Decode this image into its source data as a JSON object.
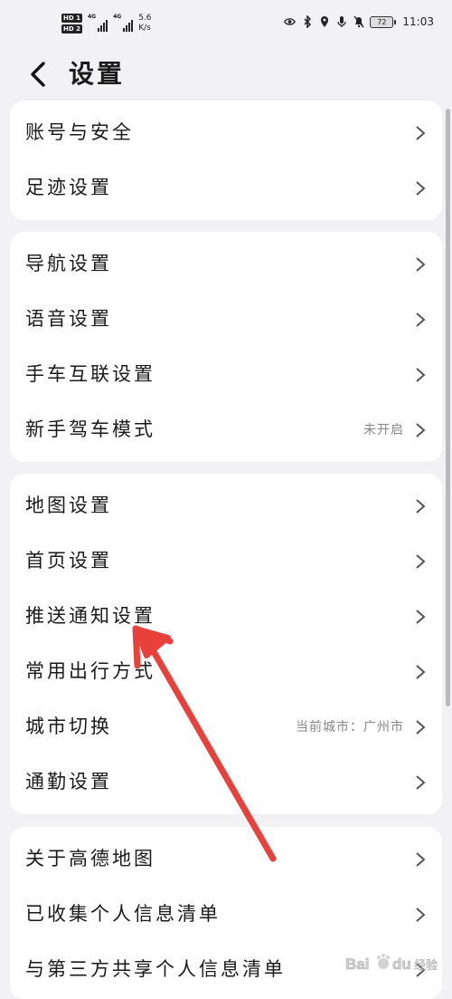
{
  "status_bar": {
    "hd1": "HD 1",
    "hd2": "HD 2",
    "net1": "4G",
    "net2": "4G",
    "speed_value": "5.6",
    "speed_unit": "K/s",
    "battery": "72",
    "time": "11:03"
  },
  "header": {
    "title": "设置",
    "back_icon": "chevron-left-icon"
  },
  "groups": [
    {
      "items": [
        {
          "label": "账号与安全"
        },
        {
          "label": "足迹设置"
        }
      ]
    },
    {
      "items": [
        {
          "label": "导航设置"
        },
        {
          "label": "语音设置"
        },
        {
          "label": "手车互联设置"
        },
        {
          "label": "新手驾车模式",
          "value": "未开启"
        }
      ]
    },
    {
      "items": [
        {
          "label": "地图设置"
        },
        {
          "label": "首页设置"
        },
        {
          "label": "推送通知设置"
        },
        {
          "label": "常用出行方式"
        },
        {
          "label": "城市切换",
          "value": "当前城市：广州市"
        },
        {
          "label": "通勤设置"
        }
      ]
    },
    {
      "items": [
        {
          "label": "关于高德地图"
        },
        {
          "label": "已收集个人信息清单"
        },
        {
          "label": "与第三方共享个人信息清单"
        }
      ]
    }
  ],
  "overlay": {
    "arrow_color": "#e8403a",
    "watermark_text": "Baidu 经验",
    "watermark_icon": "paw-icon"
  }
}
